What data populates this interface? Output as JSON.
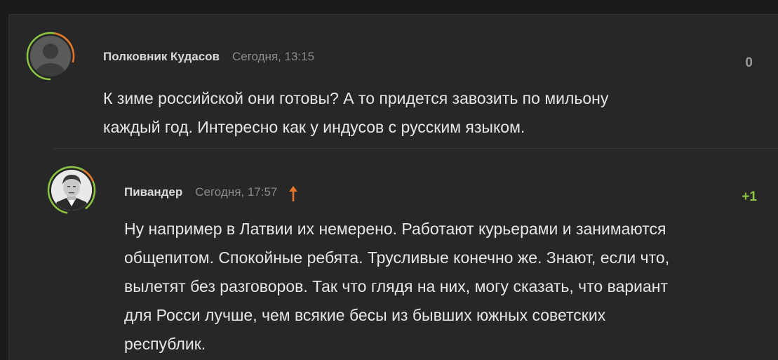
{
  "comments": [
    {
      "author": "Полковник Кудасов",
      "time": "Сегодня, 13:15",
      "rating": "0",
      "text_lines": [
        "К зиме российской они готовы? А то придется завозить по мильону",
        "каждый год. Интересно как у индусов с русским языком."
      ],
      "avatar": "default-user-silhouette"
    },
    {
      "author": "Пивандер",
      "time": "Сегодня, 17:57",
      "rating": "+1",
      "reply_arrow_icon": "arrow-up-icon",
      "text_lines": [
        "Ну например в Латвии их немерено. Работают курьерами и занимаются",
        "общепитом. Спокойные ребята. Трусливые конечно же. Знают, если что,",
        "вылетят без разговоров. Так что глядя на них, могу сказать, что вариант",
        "для Росси лучше, чем всякие бесы из бывших южных советских",
        "республик."
      ],
      "avatar": "user-photo"
    }
  ],
  "colors": {
    "background": "#1b1b1b",
    "panel": "#272727",
    "accent_orange": "#e8742a",
    "accent_green": "#8dc63f",
    "muted_text": "#8a8a8a"
  }
}
